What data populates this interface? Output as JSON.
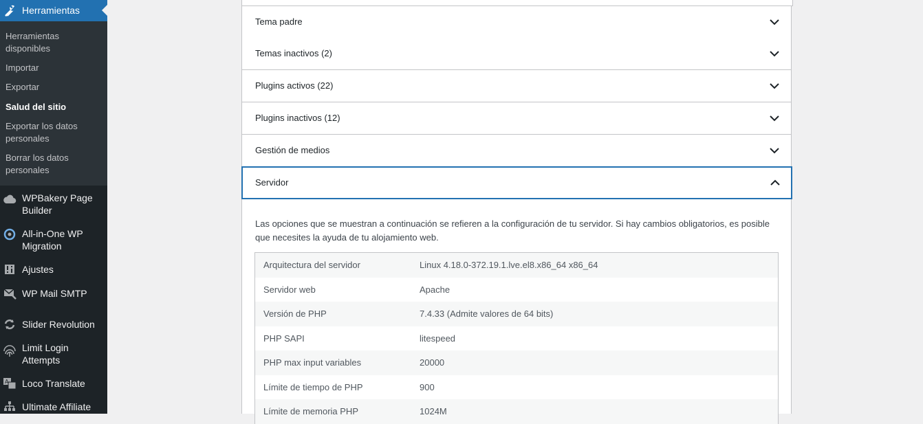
{
  "sidebar": {
    "current": {
      "label": "Herramientas",
      "icon": "wrench-icon"
    },
    "submenu": [
      {
        "label": "Herramientas disponibles",
        "active": false
      },
      {
        "label": "Importar",
        "active": false
      },
      {
        "label": "Exportar",
        "active": false
      },
      {
        "label": "Salud del sitio",
        "active": true
      },
      {
        "label": "Exportar los datos personales",
        "active": false
      },
      {
        "label": "Borrar los datos personales",
        "active": false
      }
    ],
    "items": [
      {
        "label": "WPBakery Page Builder",
        "icon": "cloud-icon"
      },
      {
        "label": "All-in-One WP Migration",
        "icon": "migration-icon"
      },
      {
        "label": "Ajustes",
        "icon": "settings-icon"
      },
      {
        "label": "WP Mail SMTP",
        "icon": "mail-icon"
      },
      {
        "label": "Slider Revolution",
        "icon": "refresh-icon"
      },
      {
        "label": "Limit Login Attempts",
        "icon": "fingerprint-icon"
      },
      {
        "label": "Loco Translate",
        "icon": "translate-icon"
      },
      {
        "label": "Ultimate Affiliate",
        "icon": "sitemap-icon"
      }
    ]
  },
  "accordion": [
    {
      "title": "Tema padre",
      "open": false
    },
    {
      "title": "Temas inactivos (2)",
      "open": false
    },
    {
      "title": "Plugins activos (22)",
      "open": false
    },
    {
      "title": "Plugins inactivos (12)",
      "open": false
    },
    {
      "title": "Gestión de medios",
      "open": false
    },
    {
      "title": "Servidor",
      "open": true
    }
  ],
  "server": {
    "description": "Las opciones que se muestran a continuación se refieren a la configuración de tu servidor. Si hay cambios obligatorios, es posible que necesites la ayuda de tu alojamiento web.",
    "rows": [
      {
        "key": "Arquitectura del servidor",
        "value": "Linux 4.18.0-372.19.1.lve.el8.x86_64 x86_64"
      },
      {
        "key": "Servidor web",
        "value": "Apache"
      },
      {
        "key": "Versión de PHP",
        "value": "7.4.33 (Admite valores de 64 bits)"
      },
      {
        "key": "PHP SAPI",
        "value": "litespeed"
      },
      {
        "key": "PHP max input variables",
        "value": "20000"
      },
      {
        "key": "Límite de tiempo de PHP",
        "value": "900"
      },
      {
        "key": "Límite de memoria PHP",
        "value": "1024M"
      }
    ]
  },
  "colors": {
    "accent": "#2271b1",
    "sidebar": "#1d2327",
    "submenu": "#2c3338"
  }
}
